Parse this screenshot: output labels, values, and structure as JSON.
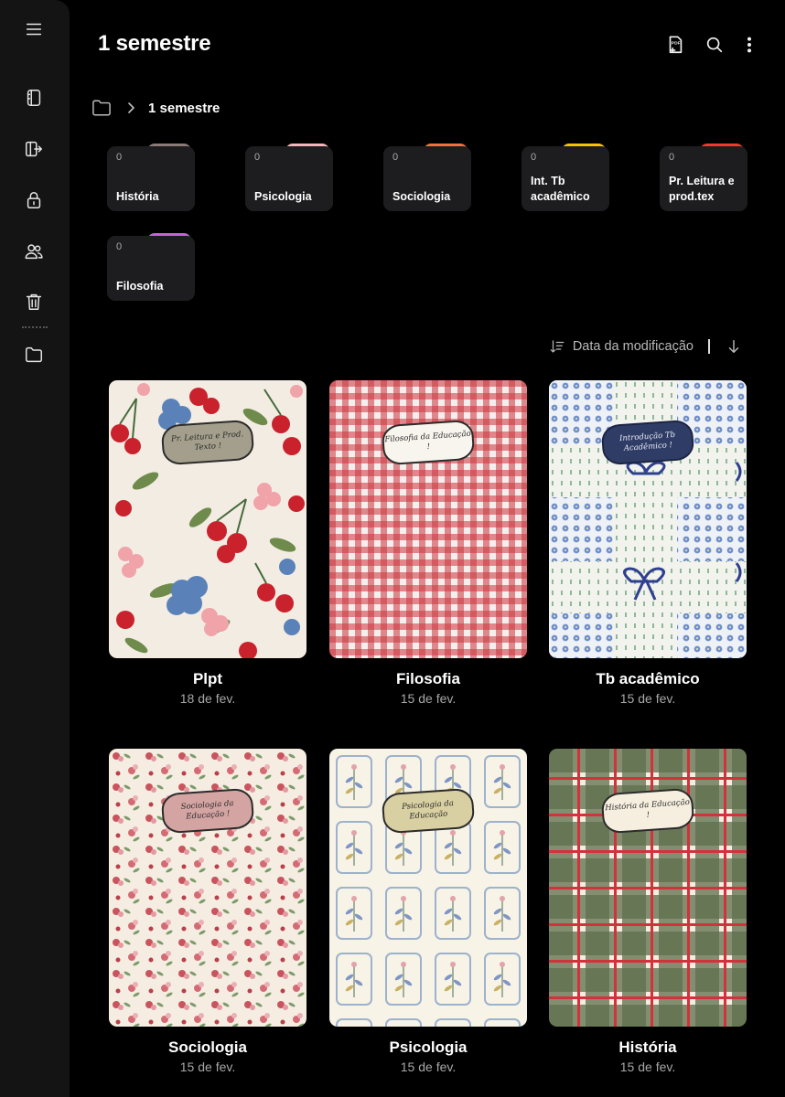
{
  "header": {
    "title": "1 semestre"
  },
  "breadcrumb": {
    "current": "1 semestre"
  },
  "rail_icons": [
    "menu-icon",
    "notebook-icon",
    "export-icon",
    "lock-icon",
    "shared-users-icon",
    "trash-icon",
    "folder-icon"
  ],
  "header_icons": [
    "pdf-import-icon",
    "search-icon",
    "more-vertical-icon"
  ],
  "folders": [
    {
      "count": "0",
      "name": "História",
      "color": "#8a7b76"
    },
    {
      "count": "0",
      "name": "Psicologia",
      "color": "#f4b6bc"
    },
    {
      "count": "0",
      "name": "Sociologia",
      "color": "#f7703c"
    },
    {
      "count": "0",
      "name": "Int. Tb acadêmico",
      "color": "#f7c400"
    },
    {
      "count": "0",
      "name": "Pr. Leitura e prod.tex",
      "color": "#f2392c"
    },
    {
      "count": "0",
      "name": "Filosofia",
      "color": "#c264d8"
    }
  ],
  "sort": {
    "label": "Data da modificação"
  },
  "notebooks": [
    {
      "title": "Plpt",
      "date": "18 de fev.",
      "label": "Pr. Leitura e Prod. Texto !"
    },
    {
      "title": "Filosofia",
      "date": "15 de fev.",
      "label": "Filosofia da Educação !"
    },
    {
      "title": "Tb acadêmico",
      "date": "15 de fev.",
      "label": "Introdução Tb Acadêmico !"
    },
    {
      "title": "Sociologia",
      "date": "15 de fev.",
      "label": "Sociologia da Educação !"
    },
    {
      "title": "Psicologia",
      "date": "15 de fev.",
      "label": "Psicologia da Educação"
    },
    {
      "title": "História",
      "date": "15 de fev.",
      "label": "História da Educação !"
    }
  ]
}
